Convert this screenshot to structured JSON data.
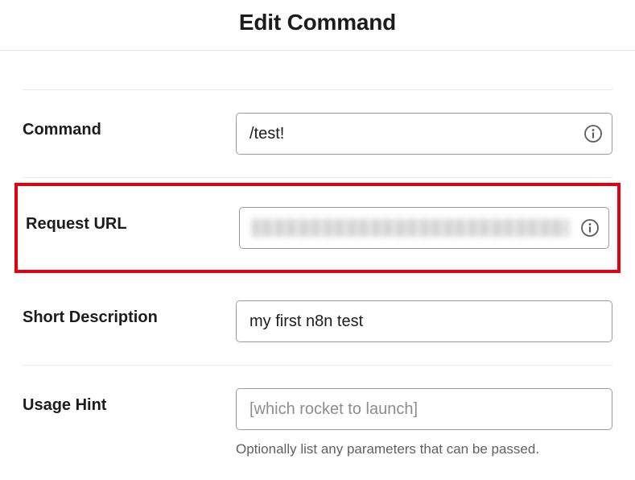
{
  "header": {
    "title": "Edit Command"
  },
  "fields": {
    "command": {
      "label": "Command",
      "value": "/test!"
    },
    "request_url": {
      "label": "Request URL",
      "value": ""
    },
    "short_description": {
      "label": "Short Description",
      "value": "my first n8n test"
    },
    "usage_hint": {
      "label": "Usage Hint",
      "placeholder": "[which rocket to launch]",
      "help": "Optionally list any parameters that can be passed."
    }
  }
}
